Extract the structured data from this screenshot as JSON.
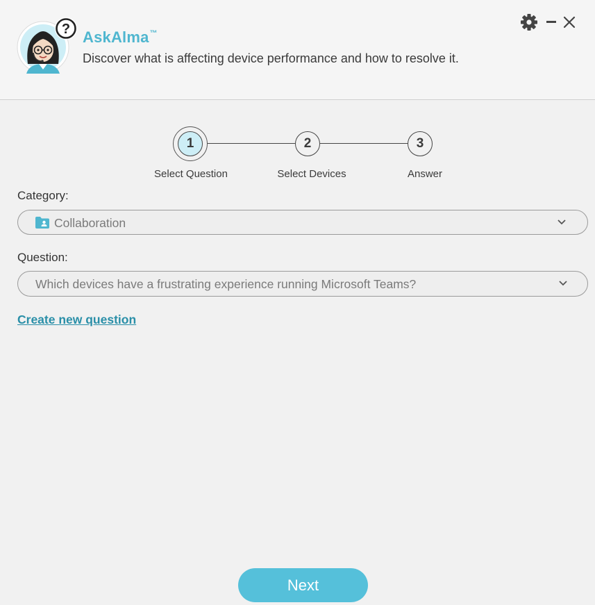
{
  "header": {
    "app_name": "AskAlma",
    "trademark": "™",
    "subtitle": "Discover what is affecting device performance and how to resolve it.",
    "help_badge_glyph": "?"
  },
  "window_controls": {
    "settings_icon": "gear-icon",
    "minimize_icon": "minimize-icon",
    "close_icon": "close-icon"
  },
  "stepper": {
    "steps": [
      {
        "number": "1",
        "label": "Select Question",
        "active": true
      },
      {
        "number": "2",
        "label": "Select Devices",
        "active": false
      },
      {
        "number": "3",
        "label": "Answer",
        "active": false
      }
    ]
  },
  "category": {
    "label": "Category:",
    "value": "Collaboration",
    "icon": "folder-user-icon"
  },
  "question": {
    "label": "Question:",
    "value": "Which devices have a frustrating experience running Microsoft Teams?"
  },
  "links": {
    "create_new_question": "Create new question"
  },
  "footer": {
    "next_label": "Next"
  },
  "colors": {
    "accent": "#55c0da",
    "title": "#4fb6cf",
    "link": "#2a8fa8",
    "active_step_fill": "#cdeef6"
  }
}
